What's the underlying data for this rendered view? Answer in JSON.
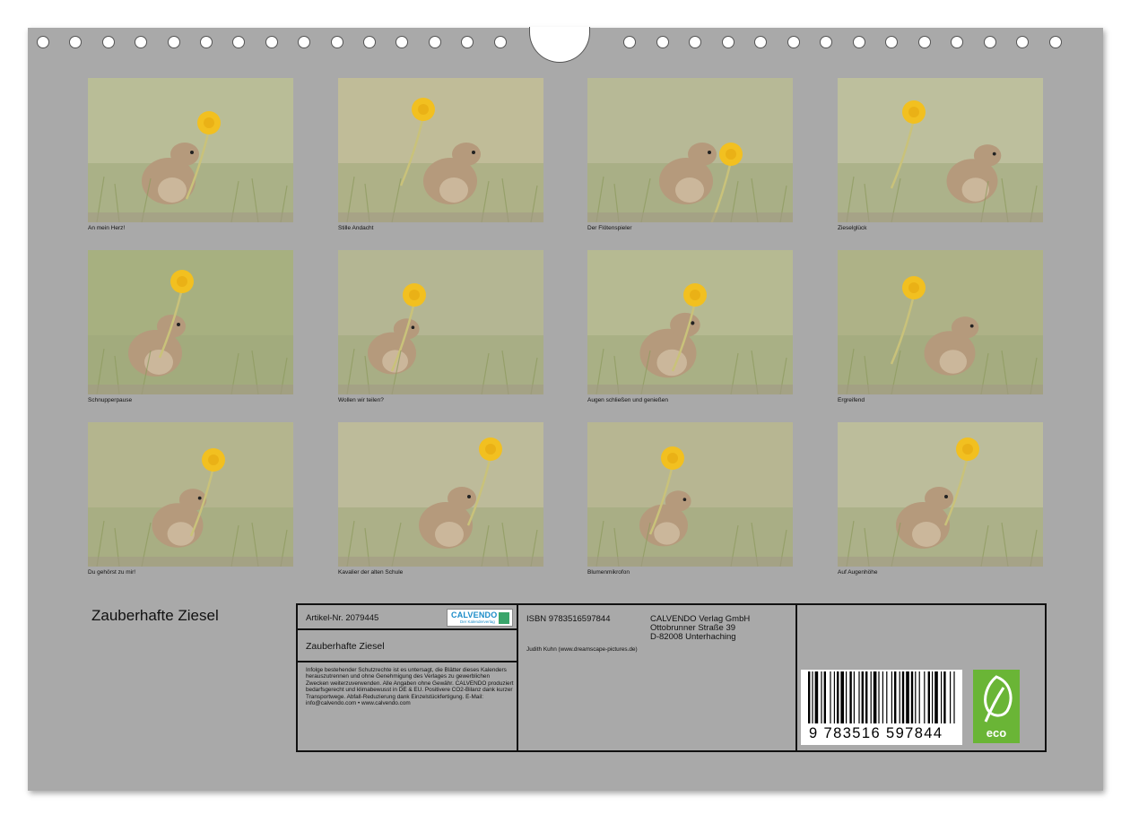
{
  "calendar": {
    "title": "Zauberhafte Ziesel",
    "hole_count_left": 15,
    "hole_count_right": 14
  },
  "months": [
    {
      "caption": "An mein Herz!"
    },
    {
      "caption": "Stille Andacht"
    },
    {
      "caption": "Der Flötenspieler"
    },
    {
      "caption": "Zieselglück"
    },
    {
      "caption": "Schnupperpause"
    },
    {
      "caption": "Wollen wir teilen?"
    },
    {
      "caption": "Augen schließen und genießen"
    },
    {
      "caption": "Ergreifend"
    },
    {
      "caption": "Du gehörst zu mir!"
    },
    {
      "caption": "Kavalier der alten Schule"
    },
    {
      "caption": "Blumenmikrofon"
    },
    {
      "caption": "Auf Augenhöhe"
    }
  ],
  "info": {
    "article": "Artikel-Nr. 2079445",
    "product_title": "Zauberhafte Ziesel",
    "legal_text": "Infolge bestehender Schutzrechte ist es untersagt, die Blätter dieses Kalenders herauszutrennen und ohne Genehmigung des Verlages zu gewerblichen Zwecken weiterzuverwenden. Alle Angaben ohne Gewähr. CALVENDO produziert bedarfsgerecht und klimabewusst in DE & EU. Positivere CO2-Bilanz dank kurzer Transportwege. Abfall-Reduzierung dank Einzelstückfertigung. E-Mail: info@calvendo.com • www.calvendo.com",
    "isbn": "ISBN 9783516597844",
    "publisher_name": "CALVENDO Verlag GmbH",
    "publisher_street": "Ottobrunner Straße 39",
    "publisher_city": "D-82008 Unterhaching",
    "photographer": "Judith Kuhn (www.dreamscape-pictures.de)",
    "barcode_number": "9  783516  597844",
    "eco_label": "eco"
  },
  "logo": {
    "name": "CALVENDO",
    "tagline": "Der Kalenderverlag",
    "color": "#1a8cc8"
  },
  "colors": {
    "sheet": "#a9a9a9",
    "dandelion": "#f2c020",
    "squirrel": "#b59a7c",
    "eco_green": "#6ab536"
  }
}
